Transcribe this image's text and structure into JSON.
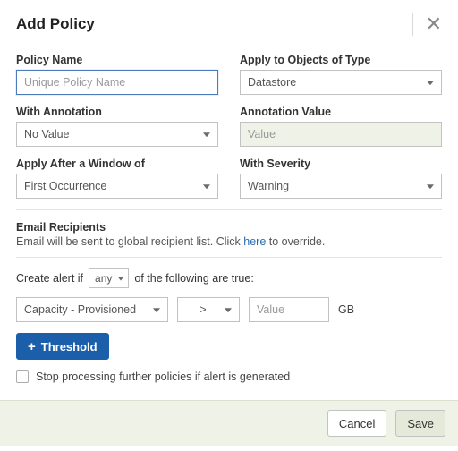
{
  "header": {
    "title": "Add Policy"
  },
  "fields": {
    "policy_name": {
      "label": "Policy Name",
      "placeholder": "Unique Policy Name"
    },
    "apply_type": {
      "label": "Apply to Objects of Type",
      "value": "Datastore"
    },
    "with_annotation": {
      "label": "With Annotation",
      "value": "No Value"
    },
    "annotation_value": {
      "label": "Annotation Value",
      "placeholder": "Value"
    },
    "apply_window": {
      "label": "Apply After a Window of",
      "value": "First Occurrence"
    },
    "with_severity": {
      "label": "With Severity",
      "value": "Warning"
    }
  },
  "email": {
    "title": "Email Recipients",
    "text_before": "Email will be sent to global recipient list. Click ",
    "link": "here",
    "text_after": " to override."
  },
  "alert": {
    "prefix": "Create alert if",
    "mode": "any",
    "suffix": "of the following are true:"
  },
  "threshold": {
    "property": "Capacity - Provisioned",
    "operator": ">",
    "value_placeholder": "Value",
    "unit": "GB",
    "add_button": "Threshold"
  },
  "stop_processing": {
    "label": "Stop processing further policies if alert is generated"
  },
  "footer": {
    "cancel": "Cancel",
    "save": "Save"
  }
}
